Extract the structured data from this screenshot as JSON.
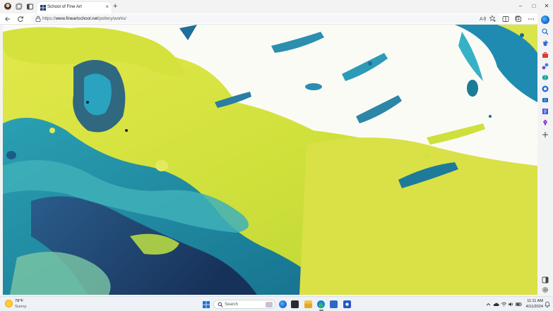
{
  "browser": {
    "tab_title": "School of Fine Art",
    "new_tab_symbol": "+",
    "close_symbol": "×",
    "url_prefix": "https://",
    "url_domain": "www.fineartschool.net",
    "url_path": "/pottery/works/"
  },
  "icons": {
    "back": "back-arrow-icon",
    "refresh": "refresh-icon",
    "lock": "lock-icon",
    "read_aloud": "read-aloud-icon",
    "favorite": "add-favorite-icon",
    "split": "split-screen-icon",
    "collections": "collections-icon",
    "more": "more-icon"
  },
  "window_controls": {
    "minimize": "–",
    "maximize": "□",
    "close": "✕"
  },
  "sidebar": {
    "items": [
      "copilot",
      "search",
      "shopping",
      "tools",
      "games",
      "microsoft-365",
      "outlook",
      "drop",
      "office",
      "designer",
      "add"
    ]
  },
  "taskbar": {
    "weather_temp": "78°F",
    "weather_cond": "Sunny",
    "search_label": "Search",
    "time": "11:11 AM",
    "date": "4/11/2024"
  },
  "colors": {
    "accent": "#0067c0",
    "paint_yellow": "#d6e23f",
    "paint_teal": "#1b8fa3",
    "paint_navy": "#1e3f6d"
  }
}
